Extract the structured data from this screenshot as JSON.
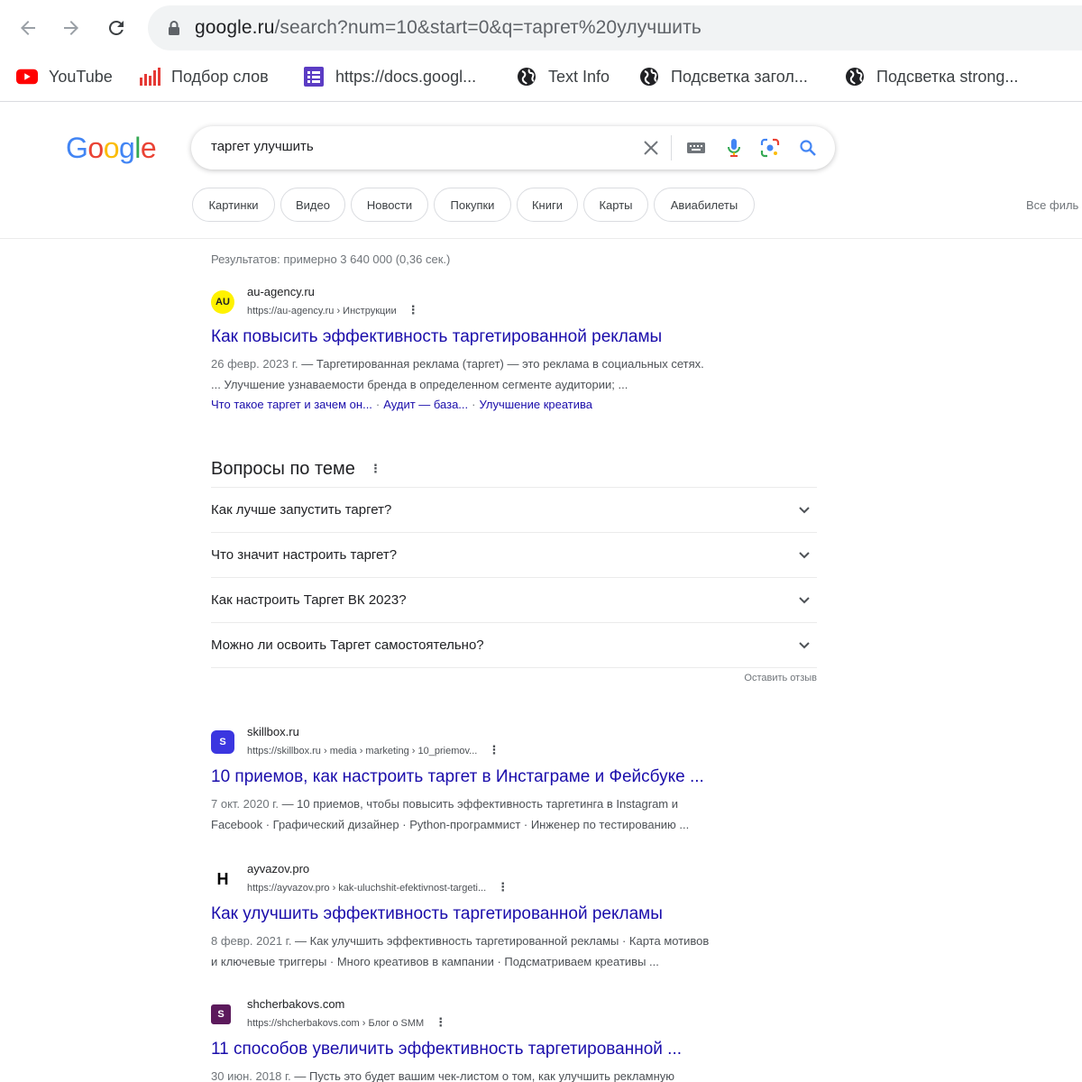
{
  "browser": {
    "url_host": "google.ru",
    "url_path": "/search?num=10&start=0&q=таргет%20улучшить",
    "bookmarks": [
      {
        "label": "YouTube",
        "icon": "youtube-icon"
      },
      {
        "label": "Подбор слов",
        "icon": "bar-chart-icon"
      },
      {
        "label": "https://docs.googl...",
        "icon": "docs-icon"
      },
      {
        "label": "Text Info",
        "icon": "globe-icon"
      },
      {
        "label": "Подсветка загол...",
        "icon": "globe-icon"
      },
      {
        "label": "Подсветка strong...",
        "icon": "globe-icon"
      }
    ]
  },
  "search": {
    "logo": [
      "G",
      "o",
      "o",
      "g",
      "l",
      "e"
    ],
    "logo_colors": [
      "#4285f4",
      "#ea4335",
      "#fbbc05",
      "#4285f4",
      "#34a853",
      "#ea4335"
    ],
    "query": "таргет улучшить",
    "chips": [
      "Картинки",
      "Видео",
      "Новости",
      "Покупки",
      "Книги",
      "Карты",
      "Авиабилеты"
    ],
    "filters_label": "Все филь"
  },
  "stats": "Результатов: примерно 3 640 000 (0,36 сек.)",
  "results": [
    {
      "site_name": "au-agency.ru",
      "breadcrumb": "https://au-agency.ru › Инструкции",
      "favicon_text": "AU",
      "title": "Как повысить эффективность таргетированной рекламы",
      "date": "26 февр. 2023 г.",
      "snippet_line1": " — Таргетированная реклама (таргет) — это реклама в социальных сетях.",
      "snippet_line2": "... Улучшение узнаваемости бренда в определенном сегменте аудитории; ...",
      "sitelinks": [
        "Что такое таргет и зачем он...",
        "Аудит — база...",
        "Улучшение креатива"
      ]
    },
    {
      "site_name": "skillbox.ru",
      "breadcrumb": "https://skillbox.ru › media › marketing › 10_priemov...",
      "favicon_text": "S",
      "title": "10 приемов, как настроить таргет в Инстаграме и Фейсбуке ...",
      "date": "7 окт. 2020 г.",
      "snippet_line1": " — 10 приемов, чтобы повысить эффективность таргетинга в Instagram и",
      "snippet_line2": "Facebook · Графический дизайнер · Python-программист · Инженер по тестированию ..."
    },
    {
      "site_name": "ayvazov.pro",
      "breadcrumb": "https://ayvazov.pro › kak-uluchshit-efektivnost-targeti...",
      "favicon_text": "H",
      "title": "Как улучшить эффективность таргетированной рекламы",
      "date": "8 февр. 2021 г.",
      "snippet_line1": " — Как улучшить эффективность таргетированной рекламы · Карта мотивов",
      "snippet_line2": "и ключевые триггеры · Много креативов в кампании · Подсматриваем креативы ..."
    },
    {
      "site_name": "shcherbakovs.com",
      "breadcrumb": "https://shcherbakovs.com › Блог о SMM",
      "favicon_text": "S",
      "title": "11 способов увеличить эффективность таргетированной ...",
      "date": "30 июн. 2018 г.",
      "snippet_line1": " — Пусть это будет вашим чек-листом о том, как улучшить рекламную"
    }
  ],
  "paa": {
    "title": "Вопросы по теме",
    "questions": [
      "Как лучше запустить таргет?",
      "Что значит настроить таргет?",
      "Как настроить Таргет ВК 2023?",
      "Можно ли освоить Таргет самостоятельно?"
    ],
    "feedback": "Оставить отзыв"
  },
  "colors": {
    "link": "#1a0dab",
    "text": "#202124",
    "secondary": "#4d5156",
    "youtube_red": "#ff0000",
    "skillbox_blue": "#3b36e0",
    "shcherbakovs_purple": "#5c1a5c"
  }
}
